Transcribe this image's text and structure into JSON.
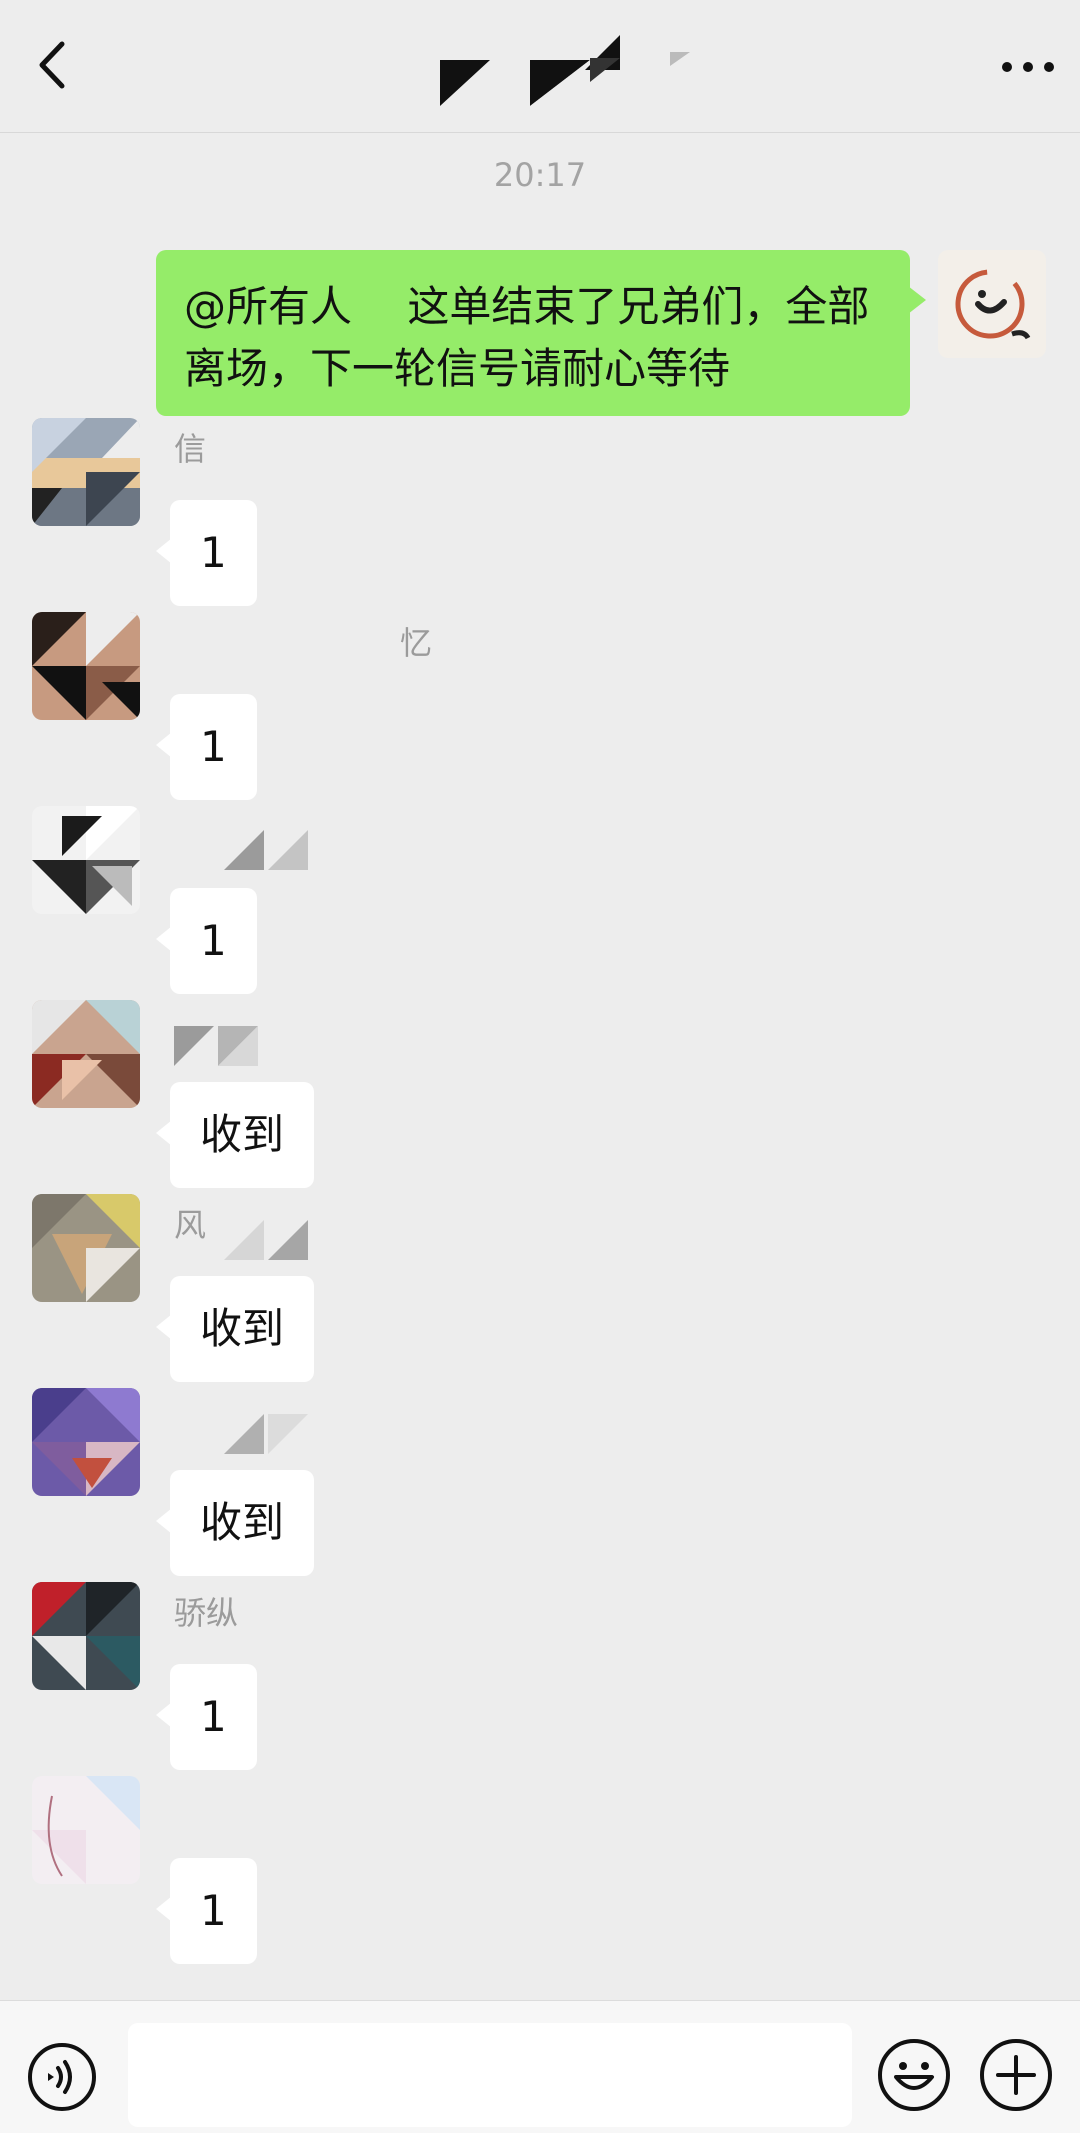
{
  "header": {
    "title": "杰哥",
    "back_icon": "chevron-left-icon",
    "more_icon": "more-dots-icon"
  },
  "timestamp": "20:17",
  "outgoing_message": {
    "text": "@所有人　 这单结束了兄弟们，全部离场，下一轮信号请耐心等待"
  },
  "messages": [
    {
      "sender": "信",
      "text": "1"
    },
    {
      "sender": "忆",
      "text": "1"
    },
    {
      "sender": "",
      "text": "1"
    },
    {
      "sender": "",
      "text": "收到"
    },
    {
      "sender": "风",
      "text": "收到"
    },
    {
      "sender": "",
      "text": "收到"
    },
    {
      "sender": "骄纵",
      "text": "1"
    },
    {
      "sender": "",
      "text": "1"
    }
  ],
  "bottom_bar": {
    "voice_icon": "voice-icon",
    "emoji_icon": "emoji-icon",
    "plus_icon": "plus-icon"
  }
}
